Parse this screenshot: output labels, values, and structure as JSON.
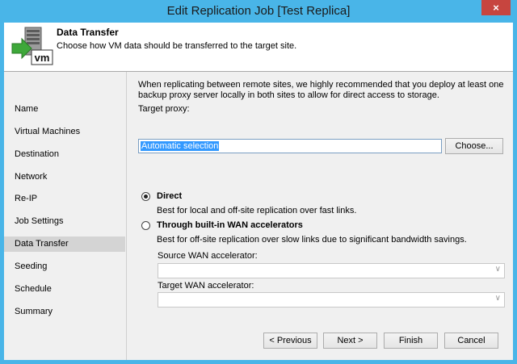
{
  "window": {
    "title": "Edit Replication Job [Test Replica]",
    "close_glyph": "×"
  },
  "header": {
    "title": "Data Transfer",
    "subtitle": "Choose how VM data should be transferred to the target site.",
    "icon_text": "vm"
  },
  "sidebar": {
    "items": [
      {
        "label": "Name"
      },
      {
        "label": "Virtual Machines"
      },
      {
        "label": "Destination"
      },
      {
        "label": "Network"
      },
      {
        "label": "Re-IP"
      },
      {
        "label": "Job Settings"
      },
      {
        "label": "Data Transfer",
        "active": true
      },
      {
        "label": "Seeding"
      },
      {
        "label": "Schedule"
      },
      {
        "label": "Summary"
      }
    ]
  },
  "content": {
    "description": "When replicating between remote sites, we highly recommended that you deploy at least one backup proxy server locally in both sites to allow for direct access to storage.",
    "target_proxy_label": "Target proxy:",
    "target_proxy_value": "Automatic selection",
    "choose_label": "Choose...",
    "direct": {
      "label": "Direct",
      "desc": "Best for local and off-site replication over fast links.",
      "selected": true
    },
    "wan": {
      "label": "Through built-in WAN accelerators",
      "desc": "Best for off-site replication over slow links due to significant bandwidth savings.",
      "selected": false
    },
    "source_wan_label": "Source WAN accelerator:",
    "source_wan_value": "",
    "target_wan_label": "Target WAN accelerator:",
    "target_wan_value": ""
  },
  "footer": {
    "previous_label": "< Previous",
    "next_label": "Next >",
    "finish_label": "Finish",
    "cancel_label": "Cancel"
  },
  "colors": {
    "titlebar": "#49b5e8",
    "selection": "#3399ff",
    "close": "#c7453f"
  }
}
